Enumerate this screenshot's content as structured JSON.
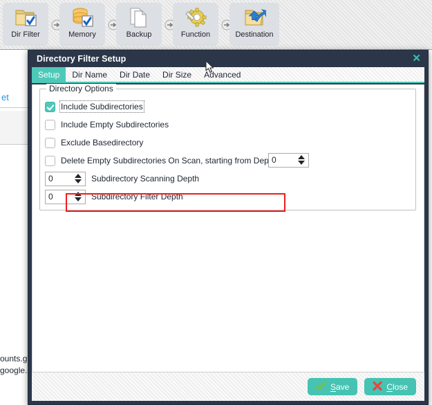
{
  "toolbar": {
    "items": [
      {
        "label": "Dir Filter",
        "icon": "folder-check-icon"
      },
      {
        "label": "Memory",
        "icon": "database-check-icon"
      },
      {
        "label": "Backup",
        "icon": "documents-copy-icon"
      },
      {
        "label": "Function",
        "icon": "gear-icon"
      },
      {
        "label": "Destination",
        "icon": "folder-arrow-icon"
      }
    ],
    "separator_icon": "arrow-right-circle-icon"
  },
  "background": {
    "link_text": "et",
    "text_line_1": "ounts.g",
    "text_line_2": "google.c"
  },
  "dialog": {
    "title": "Directory Filter Setup",
    "close_icon": "close-icon",
    "tabs": [
      {
        "label": "Setup",
        "active": true
      },
      {
        "label": "Dir Name",
        "active": false
      },
      {
        "label": "Dir Date",
        "active": false
      },
      {
        "label": "Dir Size",
        "active": false
      },
      {
        "label": "Advanced",
        "active": false
      }
    ],
    "group": {
      "legend": "Directory Options",
      "options": [
        {
          "label": "Include Subdirectories",
          "checked": true,
          "focused": true
        },
        {
          "label": "Include Empty Subdirectories",
          "checked": false,
          "focused": false
        },
        {
          "label": "Exclude Basedirectory",
          "checked": false,
          "focused": false
        },
        {
          "label": "Delete Empty Subdirectories On Scan, starting from Depth",
          "checked": false,
          "focused": false
        }
      ],
      "depth_spinner_value": "0",
      "rows": [
        {
          "value": "0",
          "label": "Subdirectory Scanning Depth"
        },
        {
          "value": "0",
          "label": "Subdirectory Filter Depth"
        }
      ]
    },
    "highlight_color": "#ee1c1c",
    "footer": {
      "save_label": "Save",
      "save_mnemonic": "S",
      "close_label": "Close",
      "close_mnemonic": "C"
    }
  },
  "colors": {
    "titlebar": "#2b3749",
    "accent": "#4ec9b9",
    "button": "#46c3b2",
    "highlight": "#ee1c1c"
  }
}
